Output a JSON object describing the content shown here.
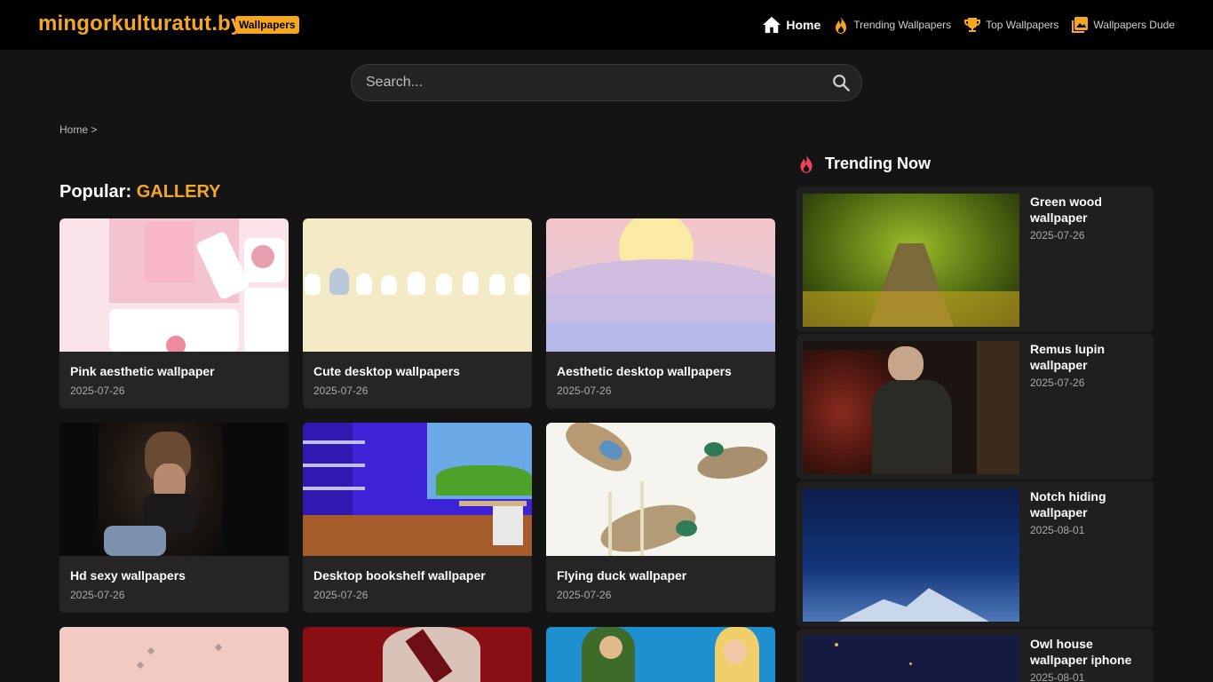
{
  "header": {
    "logo": "mingorkulturatut.by",
    "badge": "Wallpapers",
    "nav": [
      {
        "label": "Home",
        "icon": "home-icon"
      },
      {
        "label": "Trending Wallpapers",
        "icon": "fire-icon"
      },
      {
        "label": "Top Wallpapers",
        "icon": "trophy-icon"
      },
      {
        "label": "Wallpapers Dude",
        "icon": "gallery-icon"
      }
    ]
  },
  "search": {
    "placeholder": "Search..."
  },
  "breadcrumb": {
    "home": "Home",
    "separator": ">"
  },
  "section": {
    "prefix": "Popular:",
    "name": "GALLERY"
  },
  "cards": [
    {
      "title": "Pink aesthetic wallpaper",
      "date": "2025-07-26"
    },
    {
      "title": "Cute desktop wallpapers",
      "date": "2025-07-26"
    },
    {
      "title": "Aesthetic desktop wallpapers",
      "date": "2025-07-26"
    },
    {
      "title": "Hd sexy wallpapers",
      "date": "2025-07-26"
    },
    {
      "title": "Desktop bookshelf wallpaper",
      "date": "2025-07-26"
    },
    {
      "title": "Flying duck wallpaper",
      "date": "2025-07-26"
    }
  ],
  "trending": {
    "title": "Trending Now",
    "items": [
      {
        "title": "Green wood wallpaper",
        "date": "2025-07-26"
      },
      {
        "title": "Remus lupin wallpaper",
        "date": "2025-07-26"
      },
      {
        "title": "Notch hiding wallpaper",
        "date": "2025-08-01"
      },
      {
        "title": "Owl house wallpaper iphone",
        "date": "2025-08-01"
      }
    ]
  },
  "colors": {
    "accent": "#f5a623",
    "background": "#141414",
    "card": "#252525",
    "topbar": "#000000"
  }
}
